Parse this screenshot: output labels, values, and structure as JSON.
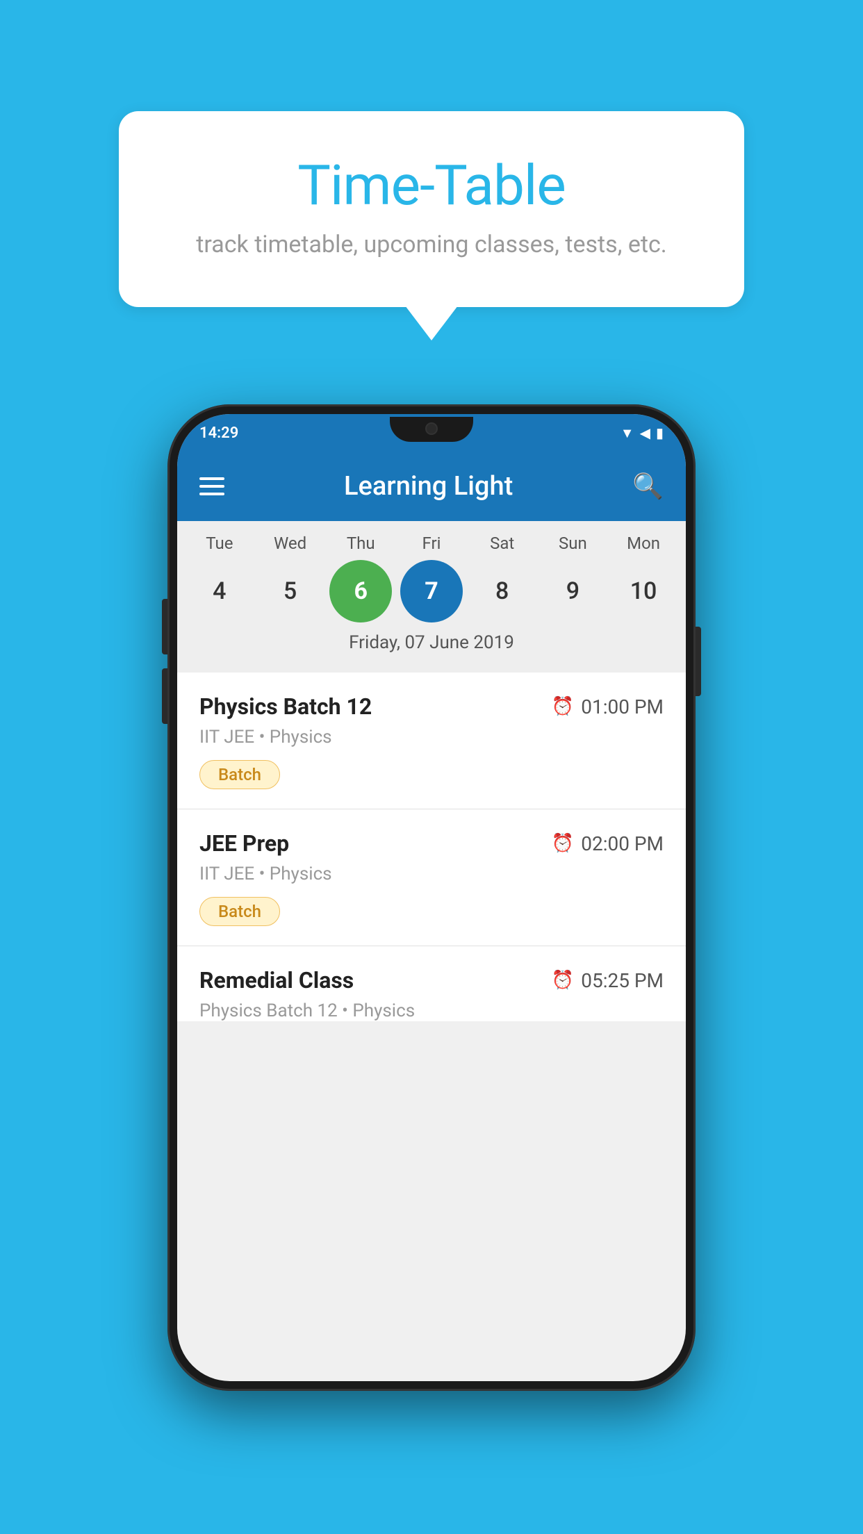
{
  "background_color": "#29b6e8",
  "speech_bubble": {
    "title": "Time-Table",
    "subtitle": "track timetable, upcoming classes, tests, etc."
  },
  "phone": {
    "status_bar": {
      "time": "14:29"
    },
    "app_bar": {
      "title": "Learning Light"
    },
    "calendar": {
      "days": [
        {
          "label": "Tue",
          "num": "4"
        },
        {
          "label": "Wed",
          "num": "5"
        },
        {
          "label": "Thu",
          "num": "6",
          "state": "today"
        },
        {
          "label": "Fri",
          "num": "7",
          "state": "selected"
        },
        {
          "label": "Sat",
          "num": "8"
        },
        {
          "label": "Sun",
          "num": "9"
        },
        {
          "label": "Mon",
          "num": "10"
        }
      ],
      "selected_date_label": "Friday, 07 June 2019"
    },
    "schedule_items": [
      {
        "title": "Physics Batch 12",
        "time": "01:00 PM",
        "sub": "IIT JEE • Physics",
        "tag": "Batch"
      },
      {
        "title": "JEE Prep",
        "time": "02:00 PM",
        "sub": "IIT JEE • Physics",
        "tag": "Batch"
      },
      {
        "title": "Remedial Class",
        "time": "05:25 PM",
        "sub": "Physics Batch 12 • Physics",
        "tag": null,
        "partial": true
      }
    ]
  }
}
